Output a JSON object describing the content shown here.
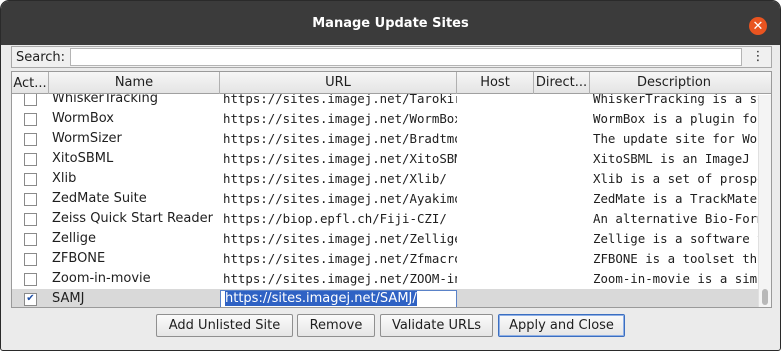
{
  "window": {
    "title": "Manage Update Sites",
    "close_glyph": "✕"
  },
  "search": {
    "label": "Search:",
    "value": "",
    "menu_glyph": "⋮"
  },
  "table": {
    "columns": [
      "Act...",
      "Name",
      "URL",
      "Host",
      "Direct...",
      "Description"
    ],
    "rows": [
      {
        "active": false,
        "name": "WhiskerTracking",
        "url": "https://sites.imagej.net/TarokiritanI/",
        "host": "",
        "directory": "",
        "description": "WhiskerTracking is a set of"
      },
      {
        "active": false,
        "name": "WormBox",
        "url": "https://sites.imagej.net/WormBox/",
        "host": "",
        "directory": "",
        "description": "WormBox is a plugin for"
      },
      {
        "active": false,
        "name": "WormSizer",
        "url": "https://sites.imagej.net/Bradtmoore/",
        "host": "",
        "directory": "",
        "description": "The update site for Worm..."
      },
      {
        "active": false,
        "name": "XitoSBML",
        "url": "https://sites.imagej.net/XitoSBML/",
        "host": "",
        "directory": "",
        "description": "XitoSBML is an ImageJ pl..."
      },
      {
        "active": false,
        "name": "Xlib",
        "url": "https://sites.imagej.net/Xlib/",
        "host": "",
        "directory": "",
        "description": "Xlib is a set of prospectiv..."
      },
      {
        "active": false,
        "name": "ZedMate Suite",
        "url": "https://sites.imagej.net/Ayakimovic...",
        "host": "",
        "directory": "",
        "description": "ZedMate is a TrackMate-b..."
      },
      {
        "active": false,
        "name": "Zeiss Quick Start Reader",
        "url": "https://biop.epfl.ch/Fiji-CZI/",
        "host": "",
        "directory": "",
        "description": "An alternative Bio-Forma..."
      },
      {
        "active": false,
        "name": "Zellige",
        "url": "https://sites.imagej.net/Zellige/",
        "host": "",
        "directory": "",
        "description": "Zellige is a software tool ..."
      },
      {
        "active": false,
        "name": "ZFBONE",
        "url": "https://sites.imagej.net/Zfmacros/",
        "host": "",
        "directory": "",
        "description": "ZFBONE is a toolset that ..."
      },
      {
        "active": false,
        "name": "Zoom-in-movie",
        "url": "https://sites.imagej.net/ZOOM-in-m...",
        "host": "",
        "directory": "",
        "description": "Zoom-in-movie is a simpl..."
      },
      {
        "active": true,
        "name": "SAMJ",
        "url": "https://sites.imagej.net/SAMJ/",
        "host": "",
        "directory": "",
        "description": "",
        "selected": true,
        "editing": true
      }
    ]
  },
  "buttons": {
    "add_unlisted": "Add Unlisted Site",
    "remove": "Remove",
    "validate": "Validate URLs",
    "apply_close": "Apply and Close"
  },
  "colors": {
    "titlebar": "#3b3b3b",
    "close": "#e95420",
    "selection": "#2f62c4"
  },
  "icons": {
    "check": "check-icon",
    "close": "close-icon",
    "menu": "kebab-menu-icon"
  }
}
